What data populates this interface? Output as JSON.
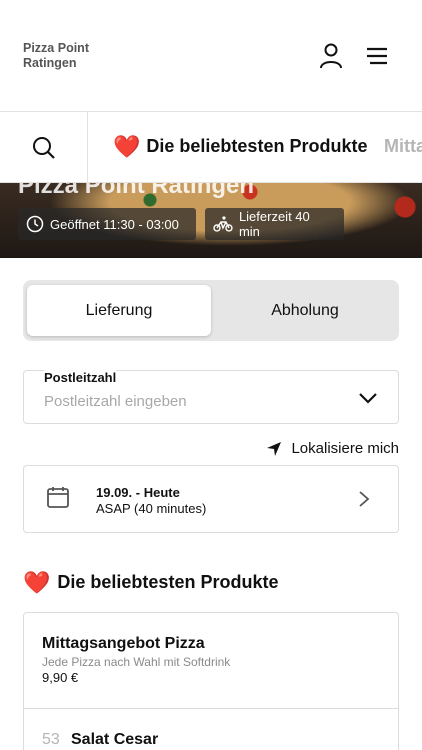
{
  "header": {
    "brand_line1": "Pizza Point",
    "brand_line2": "Ratingen",
    "user_icon": "user-icon",
    "menu_icon": "hamburger-menu-icon"
  },
  "hero": {
    "title": "Pizza Point Ratingen",
    "opening_hours": "Geöffnet 11:30 - 03:00",
    "delivery_time": "Lieferzeit 40 min"
  },
  "categories": {
    "search_icon": "search-icon",
    "active_label": "Die beliebtesten Produkte",
    "next_label": "Mitta"
  },
  "order_type": {
    "delivery": "Lieferung",
    "pickup": "Abholung",
    "selected": "Lieferung"
  },
  "postal": {
    "label": "Postleitzahl",
    "placeholder": "Postleitzahl eingeben",
    "value": ""
  },
  "locate": {
    "label": "Lokalisiere mich"
  },
  "schedule": {
    "date": "19.09. - Heute",
    "time": "ASAP (40 minutes)"
  },
  "section": {
    "title": "Die beliebtesten Produkte"
  },
  "products": [
    {
      "name": "Mittagsangebot Pizza",
      "description": "Jede Pizza nach Wahl mit Softdrink",
      "price": "9,90 €"
    },
    {
      "number": "53",
      "name": "Salat Cesar"
    }
  ],
  "colors": {
    "heart": "#e0242b",
    "segment_bg": "#e6e6e6",
    "border": "#dcdcdc"
  }
}
